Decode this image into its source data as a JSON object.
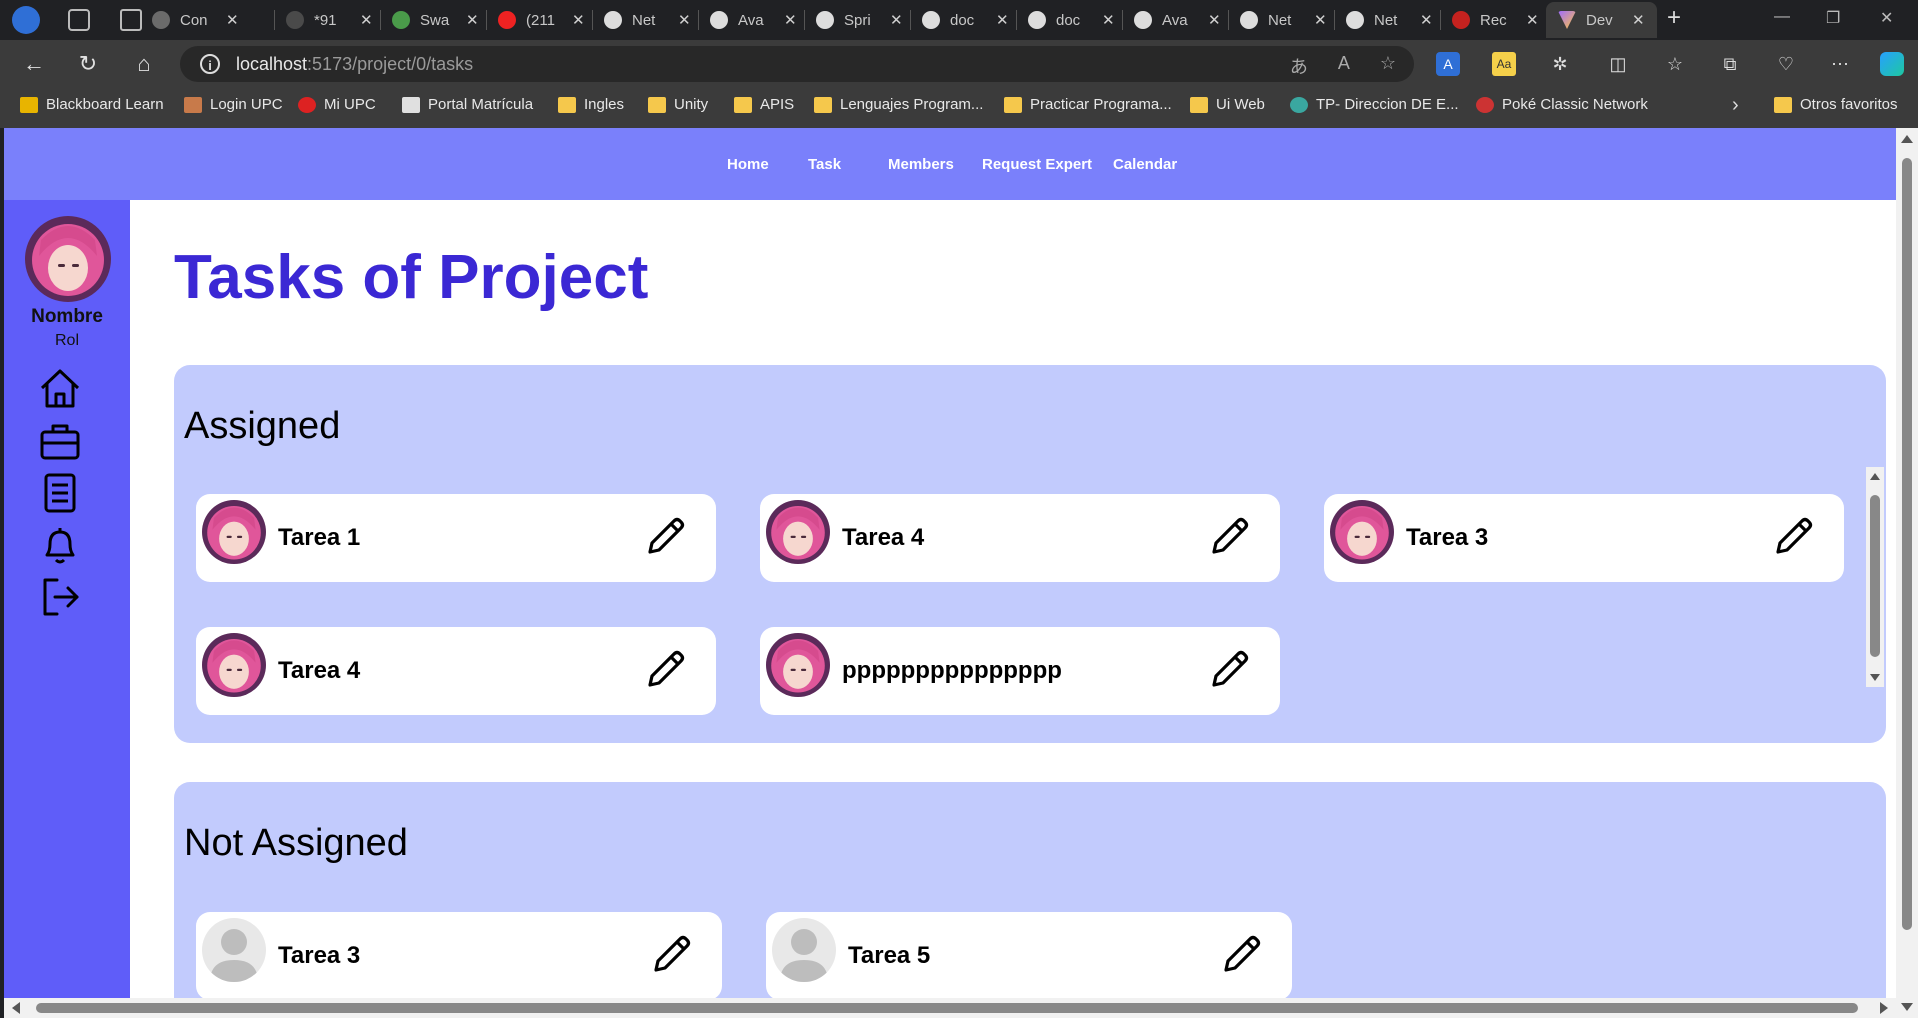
{
  "browser": {
    "tabs": [
      {
        "title": "Con",
        "color": "#6b6b6b"
      },
      {
        "title": "*91",
        "color": "#4a4a4a"
      },
      {
        "title": "Swa",
        "color": "#4a9b4a"
      },
      {
        "title": "(211",
        "color": "#e22"
      },
      {
        "title": "Net",
        "color": "#ddd"
      },
      {
        "title": "Ava",
        "color": "#ddd"
      },
      {
        "title": "Spri",
        "color": "#ddd"
      },
      {
        "title": "doc",
        "color": "#ddd"
      },
      {
        "title": "doc",
        "color": "#ddd"
      },
      {
        "title": "Ava",
        "color": "#ddd"
      },
      {
        "title": "Net",
        "color": "#ddd"
      },
      {
        "title": "Net",
        "color": "#ddd"
      },
      {
        "title": "Rec",
        "color": "#c5221f"
      }
    ],
    "active_tab": {
      "title": "Dev"
    },
    "new_tab": "+",
    "url_host": "localhost",
    "url_path": ":5173/project/0/tasks",
    "bookmarks": [
      {
        "label": "Blackboard Learn",
        "icon": "chart-icon"
      },
      {
        "label": "Login UPC",
        "icon": "person-icon"
      },
      {
        "label": "Mi UPC",
        "icon": "upc-icon"
      },
      {
        "label": "Portal Matrícula",
        "icon": "doc-icon"
      },
      {
        "label": "Ingles",
        "icon": "folder-icon"
      },
      {
        "label": "Unity",
        "icon": "folder-icon"
      },
      {
        "label": "APIS",
        "icon": "folder-icon"
      },
      {
        "label": "Lenguajes Program...",
        "icon": "folder-icon"
      },
      {
        "label": "Practicar Programa...",
        "icon": "folder-icon"
      },
      {
        "label": "Ui Web",
        "icon": "folder-icon"
      },
      {
        "label": "TP- Direccion DE E...",
        "icon": "globe-icon"
      },
      {
        "label": "Poké Classic Network",
        "icon": "pokeball-icon"
      }
    ],
    "other_favorites": "Otros favoritos"
  },
  "topnav": {
    "home": "Home",
    "task": "Task",
    "members": "Members",
    "request_expert": "Request Expert",
    "calendar": "Calendar"
  },
  "sidebar": {
    "name": "Nombre",
    "role": "Rol"
  },
  "page": {
    "title": "Tasks of Project"
  },
  "assigned": {
    "title": "Assigned",
    "tasks": [
      "Tarea 1",
      "Tarea 4",
      "Tarea 3",
      "Tarea 4",
      "ppppppppppppppp"
    ]
  },
  "not_assigned": {
    "title": "Not Assigned",
    "tasks": [
      "Tarea 3",
      "Tarea 5"
    ]
  },
  "colors": {
    "topnav": "#7a80fb",
    "sidebar": "#5f5df9",
    "title": "#3b28d4",
    "group_bg": "#c2cbfd"
  }
}
